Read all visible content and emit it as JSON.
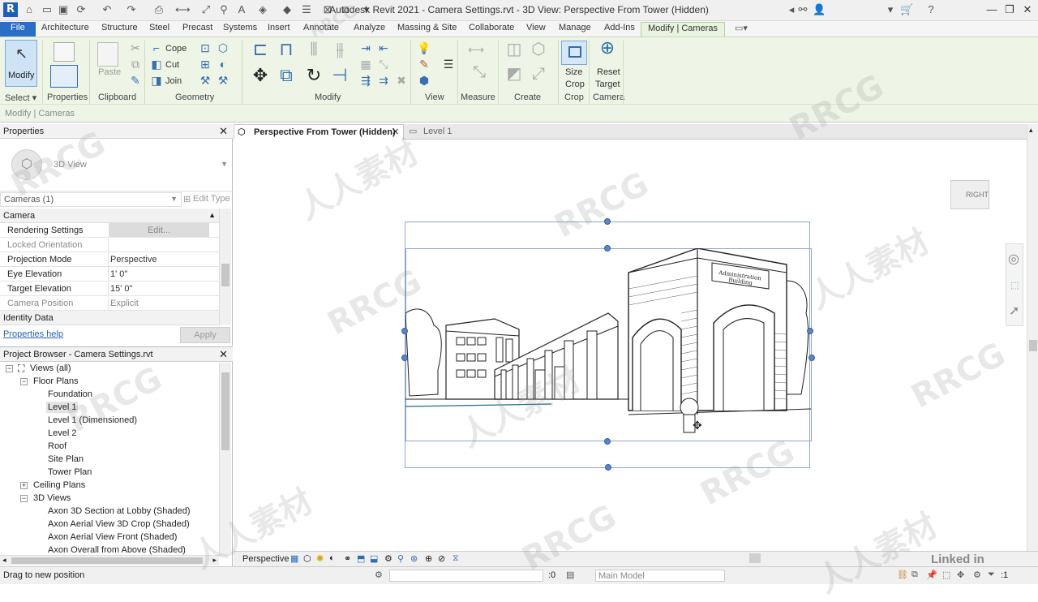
{
  "app": {
    "title": "Autodesk Revit 2021 - Camera Settings.rvt - 3D View: Perspective From Tower (Hidden)",
    "logo": "R"
  },
  "ribbon": {
    "tabs": [
      "File",
      "Architecture",
      "Structure",
      "Steel",
      "Precast",
      "Systems",
      "Insert",
      "Annotate",
      "Analyze",
      "Massing & Site",
      "Collaborate",
      "View",
      "Manage",
      "Add-Ins",
      "Modify | Cameras"
    ],
    "active_tab": "Modify | Cameras",
    "modify_label": "Modify",
    "paste_label": "Paste",
    "cope_label": "Cope",
    "cut_label": "Cut",
    "join_label": "Join",
    "size_crop_label": [
      "Size",
      "Crop"
    ],
    "reset_target_label": [
      "Reset",
      "Target"
    ],
    "panels": {
      "select": "Select",
      "properties": "Properties",
      "clipboard": "Clipboard",
      "geometry": "Geometry",
      "modify": "Modify",
      "view": "View",
      "measure": "Measure",
      "create": "Create",
      "crop": "Crop",
      "camera": "Camera"
    },
    "context_label": "Modify | Cameras"
  },
  "properties": {
    "title": "Properties",
    "type_name": "3D View",
    "selector": "Cameras (1)",
    "edit_type": "Edit Type",
    "group_camera": "Camera",
    "rows": [
      {
        "key": "Rendering Settings",
        "value": "Edit..."
      },
      {
        "key": "Locked Orientation",
        "value": ""
      },
      {
        "key": "Projection Mode",
        "value": "Perspective"
      },
      {
        "key": "Eye Elevation",
        "value": "1'  0\""
      },
      {
        "key": "Target Elevation",
        "value": "15'  0\""
      },
      {
        "key": "Camera Position",
        "value": "Explicit"
      }
    ],
    "group_identity": "Identity Data",
    "help_link": "Properties help",
    "apply": "Apply"
  },
  "browser": {
    "title": "Project Browser - Camera Settings.rvt",
    "root": "Views (all)",
    "floor_plans": "Floor Plans",
    "floor_plan_items": [
      "Foundation",
      "Level 1",
      "Level 1 (Dimensioned)",
      "Level 2",
      "Roof",
      "Site Plan",
      "Tower Plan"
    ],
    "ceiling_plans": "Ceiling Plans",
    "views_3d": "3D Views",
    "views_3d_items": [
      "Axon 3D Section at Lobby (Shaded)",
      "Axon Aerial View 3D Crop (Shaded)",
      "Axon Aerial View Front (Shaded)",
      "Axon Overall from Above (Shaded)"
    ]
  },
  "document_tabs": [
    {
      "label": "Perspective From Tower (Hidden)",
      "active": true
    },
    {
      "label": "Level 1",
      "active": false
    }
  ],
  "view": {
    "viewcube_label": "RIGHT",
    "sign_text": [
      "Administration",
      "Building"
    ],
    "view_mode": "Perspective"
  },
  "status": {
    "hint": "Drag to new position",
    "counter": ":0",
    "model": "Main Model",
    "filter": ":1"
  },
  "watermarks": {
    "latin": "RRCG",
    "cjk": "人人素材",
    "brand": "Linked in Learning"
  },
  "colors": {
    "file_tab": "#2a6fc7",
    "ribbon_bg": "#eef5e6",
    "selection": "#5a86c8"
  }
}
